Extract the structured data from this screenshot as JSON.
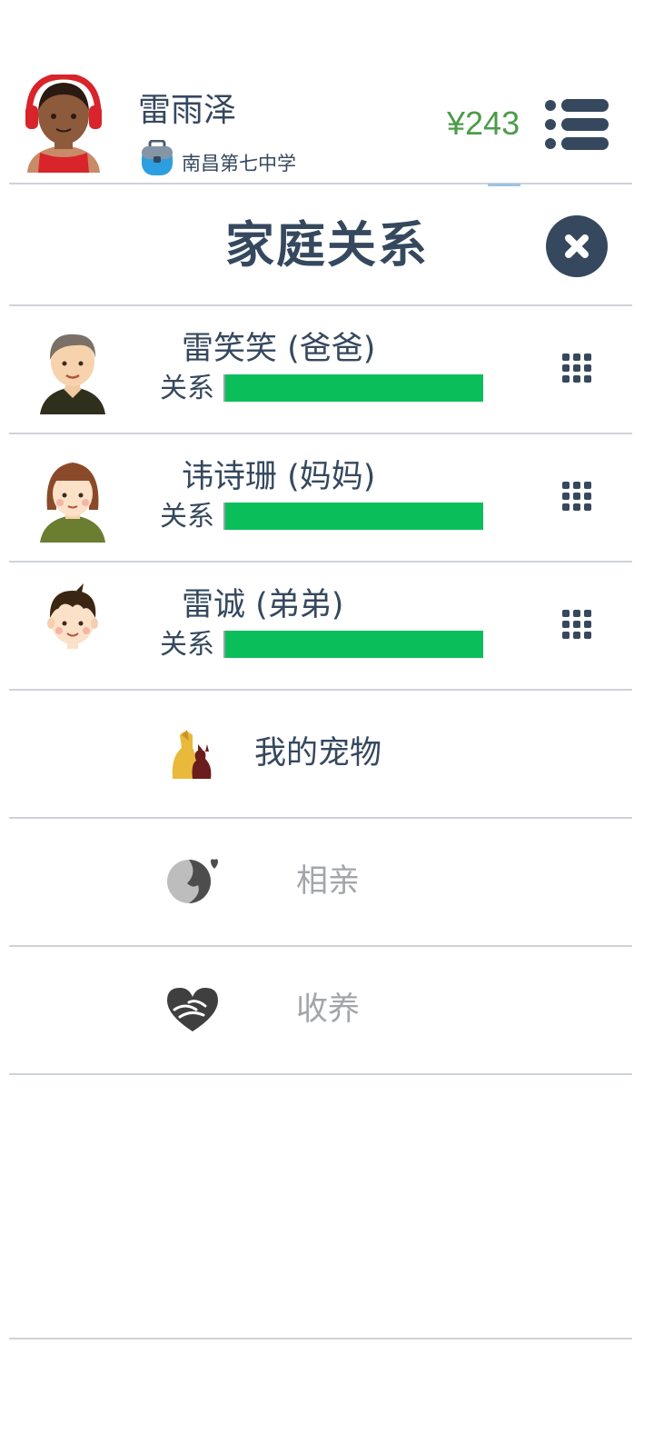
{
  "header": {
    "player_name": "雷雨泽",
    "school": "南昌第七中学",
    "money": "¥243",
    "avatar_icon": "player-avatar-red-headphones",
    "school_icon": "school-bag-icon",
    "menu_icon": "list-menu-icon"
  },
  "dialog": {
    "title": "家庭关系",
    "close_icon": "close-icon"
  },
  "family": [
    {
      "name": "雷笑笑 (爸爸)",
      "relation_label": "关系",
      "relation_level": 1.0,
      "avatar": "father-avatar"
    },
    {
      "name": "讳诗珊 (妈妈)",
      "relation_label": "关系",
      "relation_level": 1.0,
      "avatar": "mother-avatar"
    },
    {
      "name": "雷诚 (弟弟)",
      "relation_label": "关系",
      "relation_level": 1.0,
      "avatar": "brother-avatar"
    }
  ],
  "features": [
    {
      "label": "我的宠物",
      "icon": "pet-dog-icon",
      "enabled": true
    },
    {
      "label": "相亲",
      "icon": "dating-icon",
      "enabled": false
    },
    {
      "label": "收养",
      "icon": "adoption-heart-icon",
      "enabled": false
    }
  ],
  "colors": {
    "text_primary": "#35485e",
    "text_disabled": "#a3a6a9",
    "money_green": "#4e9b4a",
    "relation_bar": "#0abf5a",
    "divider": "#cfd3d8"
  }
}
